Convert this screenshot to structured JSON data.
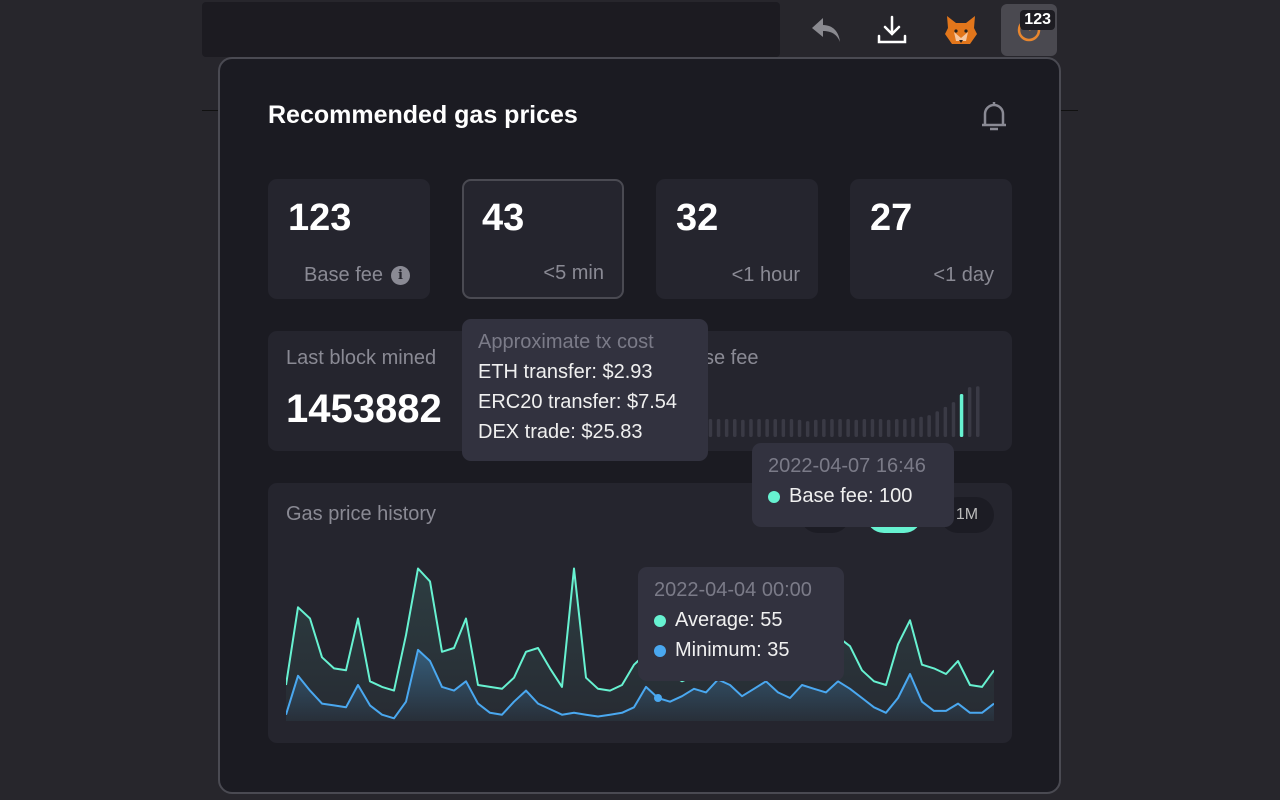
{
  "toolbar": {
    "badge": "123",
    "icons": [
      "back-icon",
      "download-icon",
      "metamask-fox-icon",
      "gas-extension-icon"
    ]
  },
  "popup": {
    "title": "Recommended gas prices",
    "cards": [
      {
        "value": "123",
        "label": "Base fee",
        "info": "i"
      },
      {
        "value": "43",
        "label": "<5 min"
      },
      {
        "value": "32",
        "label": "<1 hour"
      },
      {
        "value": "27",
        "label": "<1 day"
      }
    ],
    "last_block": {
      "label": "Last block mined ",
      "value": "1453882",
      "basefee_label": "se fee"
    },
    "tx_tooltip": {
      "title": "Approximate tx cost",
      "lines": [
        "ETH transfer: $2.93",
        "ERC20 transfer: $7.54",
        "DEX trade: $25.83"
      ]
    },
    "basefee_tooltip": {
      "date": "2022-04-07 16:46",
      "line": "Base fee: 100"
    },
    "history": {
      "title": "Gas price history",
      "ranges": [
        "",
        "",
        "1M"
      ]
    },
    "history_tooltip": {
      "date": "2022-04-04 00:00",
      "average": "Average: 55",
      "minimum": "Minimum: 35"
    }
  },
  "colors": {
    "accent": "#67f2d1",
    "minimum": "#4aa8f0",
    "bar": "#3a3a45"
  },
  "chart_data": [
    {
      "type": "bar",
      "name": "Base fee",
      "highlight_index": 33,
      "highlight_value": 100,
      "values": [
        42,
        42,
        42,
        42,
        42,
        42,
        40,
        42,
        42,
        42,
        42,
        42,
        42,
        40,
        37,
        40,
        42,
        42,
        42,
        42,
        40,
        42,
        42,
        42,
        40,
        42,
        42,
        44,
        47,
        51,
        60,
        70,
        81,
        100,
        116,
        118
      ]
    },
    {
      "type": "area",
      "title": "Gas price history",
      "highlight_index": 31,
      "series": [
        {
          "name": "Average",
          "values": [
            42,
            84,
            78,
            57,
            51,
            50,
            78,
            44,
            41,
            39,
            69,
            105,
            98,
            60,
            62,
            78,
            42,
            41,
            40,
            46,
            60,
            62,
            51,
            41,
            105,
            46,
            40,
            39,
            42,
            53,
            59,
            55,
            48,
            44,
            47,
            52,
            58,
            50,
            62,
            66,
            70,
            58,
            52,
            64,
            60,
            55,
            68,
            63,
            50,
            44,
            42,
            64,
            77,
            53,
            51,
            48,
            55,
            42,
            41,
            50
          ]
        },
        {
          "name": "Minimum",
          "values": [
            26,
            47,
            39,
            32,
            31,
            30,
            42,
            31,
            26,
            24,
            33,
            61,
            55,
            41,
            39,
            44,
            32,
            27,
            26,
            33,
            39,
            32,
            29,
            26,
            27,
            26,
            25,
            26,
            27,
            30,
            41,
            35,
            33,
            36,
            40,
            38,
            45,
            42,
            36,
            40,
            44,
            38,
            35,
            42,
            40,
            38,
            44,
            40,
            35,
            30,
            27,
            35,
            48,
            33,
            28,
            28,
            32,
            27,
            27,
            32
          ]
        }
      ]
    }
  ]
}
